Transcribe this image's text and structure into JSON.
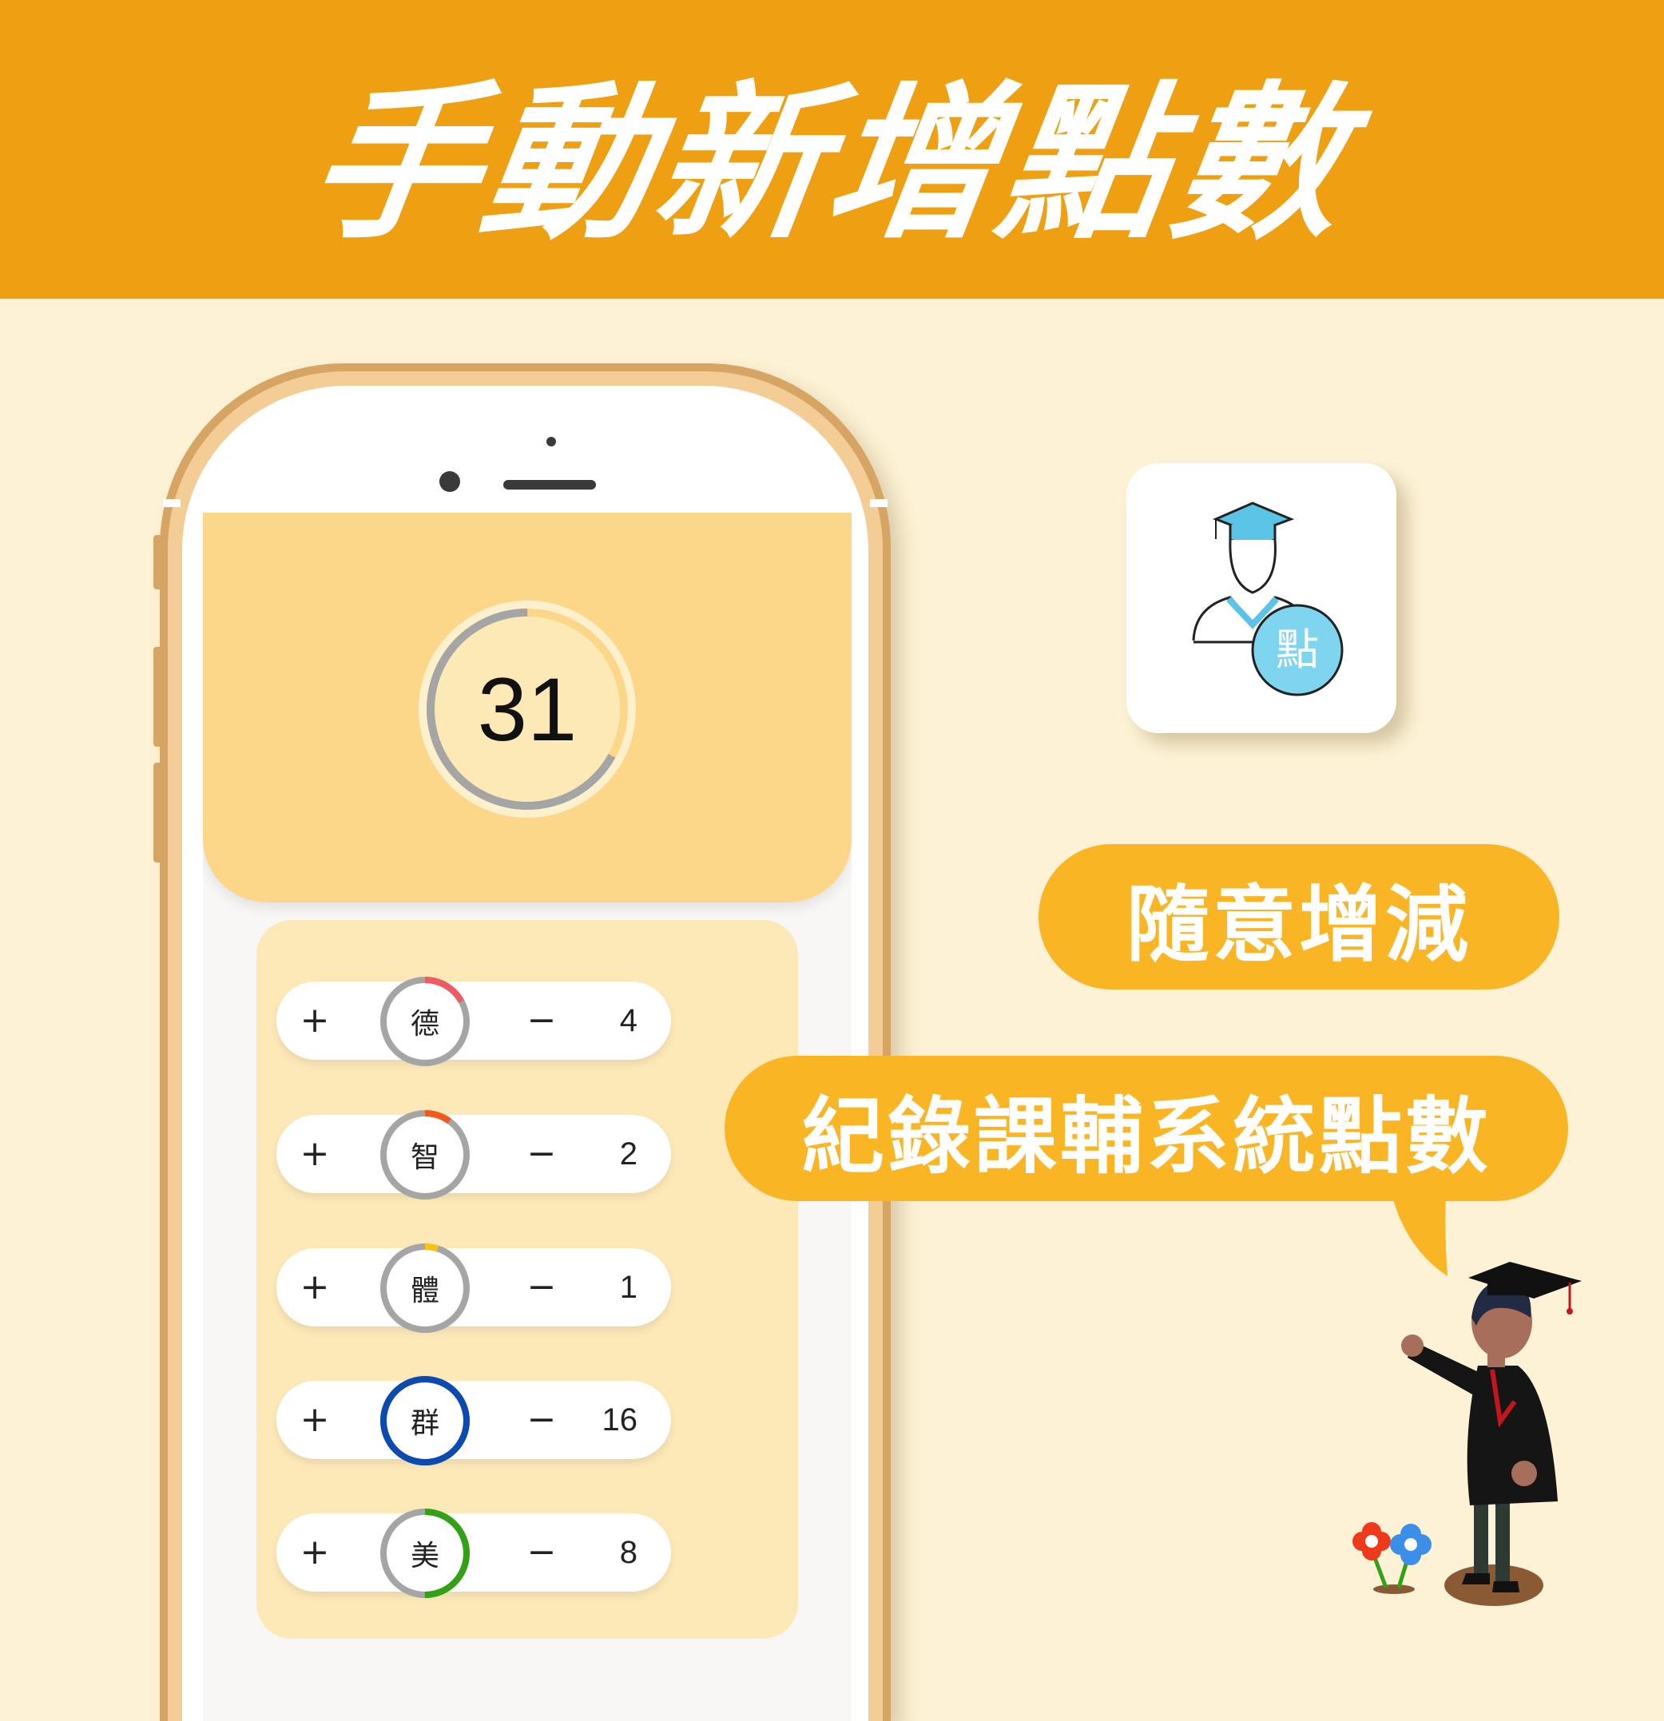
{
  "header": {
    "title": "手動新增點數"
  },
  "phone": {
    "total_score": "31",
    "total_progress": 0.67,
    "categories": [
      {
        "label": "德",
        "plus": "+",
        "minus": "−",
        "count": "4",
        "color": "#ee5b62",
        "progress": 0.17
      },
      {
        "label": "智",
        "plus": "+",
        "minus": "−",
        "count": "2",
        "color": "#f25a1d",
        "progress": 0.1
      },
      {
        "label": "體",
        "plus": "+",
        "minus": "−",
        "count": "1",
        "color": "#f4c315",
        "progress": 0.05
      },
      {
        "label": "群",
        "plus": "+",
        "minus": "−",
        "count": "16",
        "color": "#0a4ab1",
        "progress": 1.0
      },
      {
        "label": "美",
        "plus": "+",
        "minus": "−",
        "count": "8",
        "color": "#32a116",
        "progress": 0.5
      }
    ]
  },
  "app_icon": {
    "glyph": "點",
    "icon_name": "graduate-point-app-icon"
  },
  "callouts": {
    "primary": "隨意增減",
    "secondary": "紀錄課輔系統點數"
  },
  "colors": {
    "banner": "#ee9f12",
    "background": "#fdf2d5",
    "pill": "#fab525",
    "score_card": "#fcd78a",
    "ring_track": "#a5a5a5"
  }
}
